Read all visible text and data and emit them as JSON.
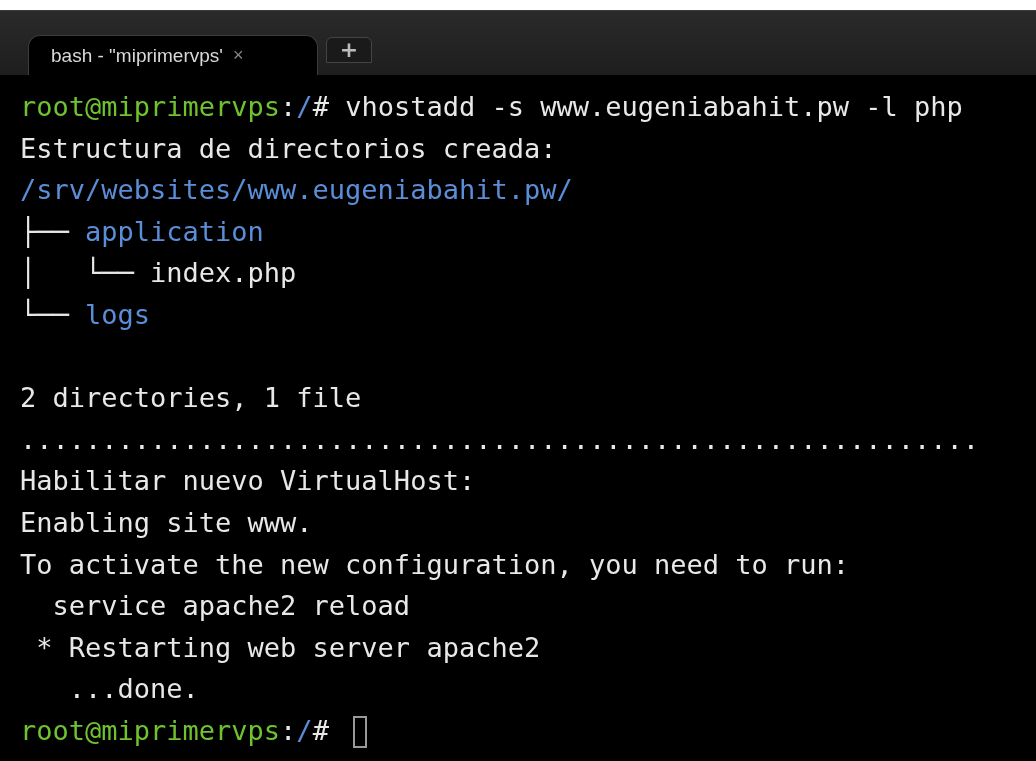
{
  "tabs": [
    {
      "label": "bash - \"miprimervps'",
      "close": "×",
      "selected": true
    }
  ],
  "new_tab": "+",
  "terminal": {
    "lines": [
      {
        "kind": "text",
        "segments": [
          {
            "kind": "user",
            "text": "root@miprimervps"
          },
          {
            "kind": "plain",
            "text": ":"
          },
          {
            "kind": "path",
            "text": "/"
          },
          {
            "kind": "plain",
            "text": "# vhostadd -s www.eugeniabahit.pw -l php"
          }
        ]
      },
      {
        "kind": "text",
        "segments": [
          {
            "kind": "plain",
            "text": "Estructura de directorios creada:"
          }
        ]
      },
      {
        "kind": "text",
        "segments": [
          {
            "kind": "path",
            "text": "/srv/websites/www.eugeniabahit.pw/"
          }
        ]
      },
      {
        "kind": "text",
        "segments": [
          {
            "kind": "plain",
            "text": "├── "
          },
          {
            "kind": "path",
            "text": "application"
          }
        ]
      },
      {
        "kind": "text",
        "segments": [
          {
            "kind": "plain",
            "text": "│   └── index.php"
          }
        ]
      },
      {
        "kind": "text",
        "segments": [
          {
            "kind": "plain",
            "text": "└── "
          },
          {
            "kind": "path",
            "text": "logs"
          }
        ]
      },
      {
        "kind": "blank"
      },
      {
        "kind": "text",
        "segments": [
          {
            "kind": "plain",
            "text": "2 directories, 1 file"
          }
        ]
      },
      {
        "kind": "text",
        "segments": [
          {
            "kind": "plain",
            "text": "..........................................................."
          }
        ]
      },
      {
        "kind": "text",
        "segments": [
          {
            "kind": "plain",
            "text": "Habilitar nuevo VirtualHost:"
          }
        ]
      },
      {
        "kind": "text",
        "segments": [
          {
            "kind": "plain",
            "text": "Enabling site www."
          }
        ]
      },
      {
        "kind": "text",
        "segments": [
          {
            "kind": "plain",
            "text": "To activate the new configuration, you need to run:"
          }
        ]
      },
      {
        "kind": "text",
        "segments": [
          {
            "kind": "plain",
            "text": "  service apache2 reload"
          }
        ]
      },
      {
        "kind": "text",
        "segments": [
          {
            "kind": "plain",
            "text": " * Restarting web server apache2"
          }
        ]
      },
      {
        "kind": "text",
        "segments": [
          {
            "kind": "plain",
            "text": "   ...done."
          }
        ]
      },
      {
        "kind": "text",
        "cursor": true,
        "segments": [
          {
            "kind": "user",
            "text": "root@miprimervps"
          },
          {
            "kind": "plain",
            "text": ":"
          },
          {
            "kind": "path",
            "text": "/"
          },
          {
            "kind": "plain",
            "text": "#"
          }
        ]
      }
    ]
  }
}
